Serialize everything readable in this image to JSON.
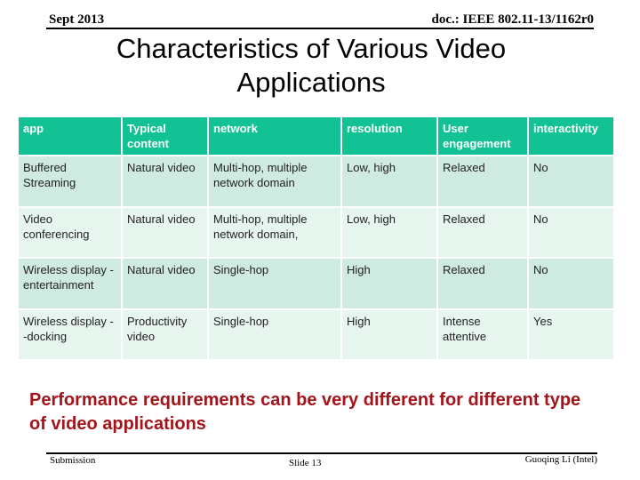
{
  "header": {
    "date": "Sept 2013",
    "doc_id": "doc.: IEEE 802.11-13/1162r0"
  },
  "title": "Characteristics of Various Video Applications",
  "table": {
    "columns": [
      "app",
      "Typical content",
      "network",
      "resolution",
      "User engagement",
      "interactivity"
    ],
    "rows": [
      [
        "Buffered Streaming",
        "Natural video",
        "Multi-hop, multiple network domain",
        "Low, high",
        "Relaxed",
        "No"
      ],
      [
        "Video conferencing",
        "Natural video",
        "Multi-hop, multiple network domain,",
        "Low, high",
        "Relaxed",
        "No"
      ],
      [
        "Wireless display -entertainment",
        "Natural video",
        "Single-hop",
        "High",
        "Relaxed",
        "No"
      ],
      [
        "Wireless display --docking",
        "Productivity video",
        "Single-hop",
        "High",
        "Intense attentive",
        "Yes"
      ]
    ],
    "colors": {
      "header_bg": "#13c294",
      "row_odd_bg": "#cfeae0",
      "row_even_bg": "#e7f5ef"
    }
  },
  "callout": {
    "text": "Performance requirements can be very different for different type of video applications",
    "color": "#a3141b"
  },
  "footer": {
    "left": "Submission",
    "center": "Slide 13",
    "right": "Guoqing Li (Intel)"
  }
}
